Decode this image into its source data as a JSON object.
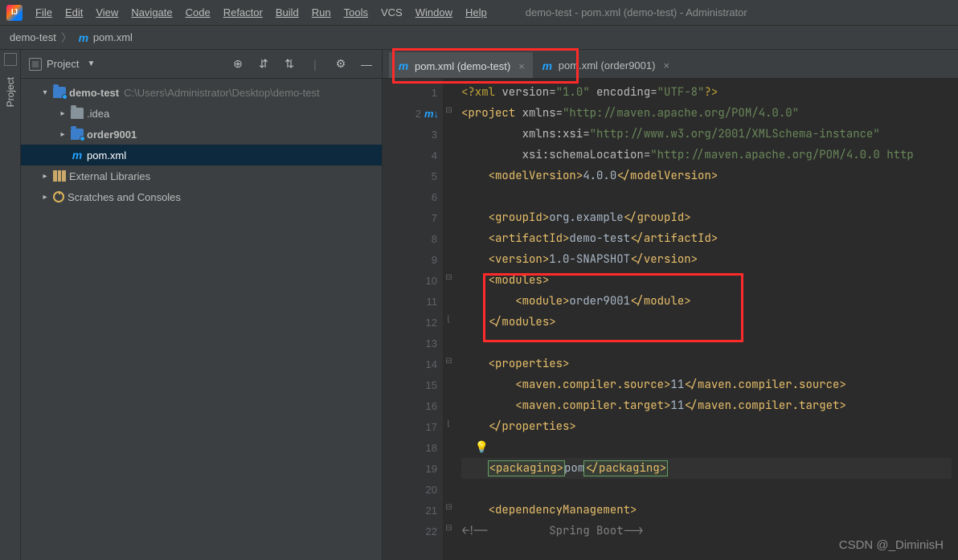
{
  "menu": {
    "file": "File",
    "edit": "Edit",
    "view": "View",
    "navigate": "Navigate",
    "code": "Code",
    "refactor": "Refactor",
    "build": "Build",
    "run": "Run",
    "tools": "Tools",
    "vcs": "VCS",
    "window": "Window",
    "help": "Help"
  },
  "window_title": "demo-test - pom.xml (demo-test) - Administrator",
  "breadcrumb": {
    "item1": "demo-test",
    "item2": "pom.xml"
  },
  "left_rail": {
    "project_label": "Project"
  },
  "project_panel": {
    "header": "Project",
    "nodes": {
      "root_name": "demo-test",
      "root_path": "C:\\Users\\Administrator\\Desktop\\demo-test",
      "idea": ".idea",
      "order9001": "order9001",
      "pom": "pom.xml",
      "ext_libs": "External Libraries",
      "scratches": "Scratches and Consoles"
    }
  },
  "tabs": {
    "tab1": "pom.xml (demo-test)",
    "tab2": "pom.xml (order9001)"
  },
  "gutter": {
    "lines": [
      "1",
      "2",
      "3",
      "4",
      "5",
      "6",
      "7",
      "8",
      "9",
      "10",
      "11",
      "12",
      "13",
      "14",
      "15",
      "16",
      "17",
      "18",
      "19",
      "20",
      "21",
      "22"
    ]
  },
  "code": {
    "xml_pi_open": "<?xml ",
    "xml_pi_attr1": "version",
    "xml_pi_eq": "=",
    "xml_pi_v1": "\"1.0\"",
    "xml_pi_attr2": "encoding",
    "xml_pi_v2": "\"UTF-8\"",
    "xml_pi_close": "?>",
    "project_open": "project",
    "xmlns_attr": "xmlns",
    "xmlns_val": "\"http://maven.apache.org/POM/4.0.0\"",
    "xmlns_xsi_attr": "xmlns:xsi",
    "xmlns_xsi_val": "\"http://www.w3.org/2001/XMLSchema-instance\"",
    "schema_attr": "xsi:schemaLocation",
    "schema_val": "\"http://maven.apache.org/POM/4.0.0 http",
    "modelVersion_tag": "modelVersion",
    "modelVersion_val": "4.0.0",
    "groupId_tag": "groupId",
    "groupId_val": "org.example",
    "artifactId_tag": "artifactId",
    "artifactId_val": "demo-test",
    "version_tag": "version",
    "version_val": "1.0-SNAPSHOT",
    "modules_tag": "modules",
    "module_tag": "module",
    "module_val": "order9001",
    "properties_tag": "properties",
    "mcs_tag": "maven.compiler.source",
    "mcs_val": "11",
    "mct_tag": "maven.compiler.target",
    "mct_val": "11",
    "packaging_tag": "packaging",
    "packaging_val": "pom",
    "depmgmt_tag": "dependencyManagement",
    "comment_open": "<!--",
    "comment_text": "         Spring Boot",
    "comment_close": "-->"
  },
  "watermark": "CSDN @_DiminisH"
}
